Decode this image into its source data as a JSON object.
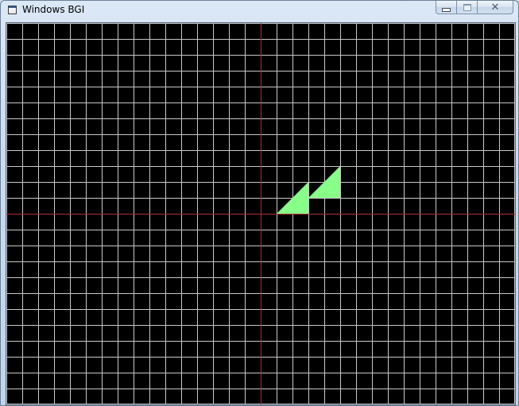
{
  "window": {
    "title": "Windows BGI",
    "controls": {
      "minimize_icon": "minimize-icon",
      "maximize_icon": "maximize-icon",
      "close_icon": "close-icon"
    }
  },
  "canvas": {
    "background_color": "#000000",
    "grid_color": "#c8c8c8",
    "axis_color": "#b03030",
    "shape_color": "#88ff88",
    "grid_spacing_units": 1,
    "x_range": [
      -16,
      16
    ],
    "y_range": [
      -12,
      12
    ],
    "axes": {
      "x_axis_at_y": 0,
      "y_axis_at_x": 0
    },
    "shapes": [
      {
        "name": "triangle-1",
        "points": [
          [
            1,
            0
          ],
          [
            3,
            0
          ],
          [
            3,
            2
          ]
        ]
      },
      {
        "name": "triangle-2",
        "points": [
          [
            3,
            1
          ],
          [
            5,
            1
          ],
          [
            5,
            3
          ]
        ]
      }
    ]
  }
}
